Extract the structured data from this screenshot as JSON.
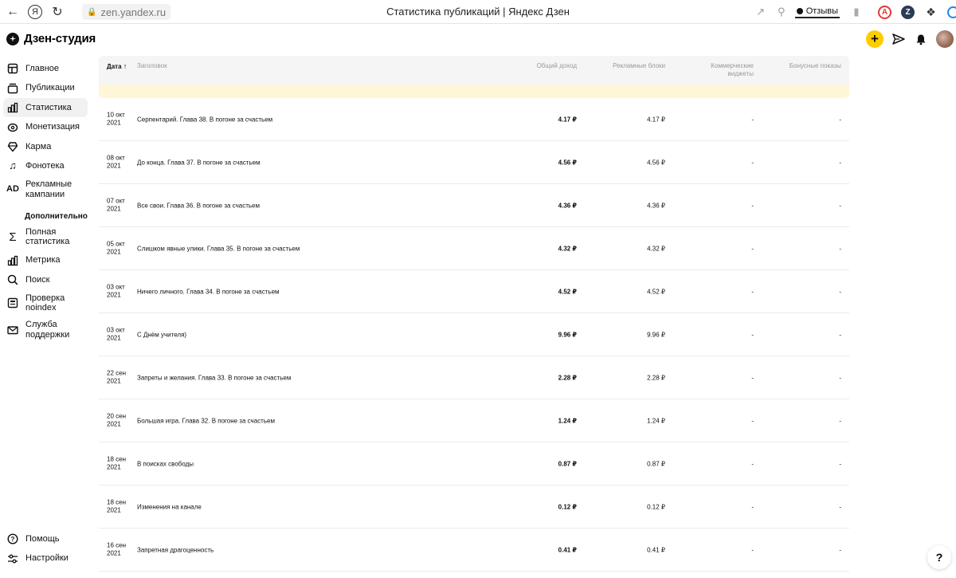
{
  "browser": {
    "url": "zen.yandex.ru",
    "tab_title": "Статистика публикаций | Яндекс Дзен",
    "reviews_label": "Отзывы",
    "ya_label": "Я"
  },
  "app": {
    "title": "Дзен-студия"
  },
  "sidebar": {
    "items": [
      {
        "label": "Главное",
        "icon": "home-icon"
      },
      {
        "label": "Публикации",
        "icon": "publications-icon"
      },
      {
        "label": "Статистика",
        "icon": "statistics-icon",
        "active": true
      },
      {
        "label": "Монетизация",
        "icon": "monetization-icon"
      },
      {
        "label": "Карма",
        "icon": "karma-icon"
      },
      {
        "label": "Фонотека",
        "icon": "music-icon"
      },
      {
        "label": "Рекламные кампании",
        "icon": "ad-icon",
        "glyph": "AD"
      }
    ],
    "section_title": "Дополнительно",
    "extra_items": [
      {
        "label": "Полная статистика",
        "icon": "sigma-icon"
      },
      {
        "label": "Метрика",
        "icon": "metrika-icon"
      },
      {
        "label": "Поиск",
        "icon": "search-icon"
      },
      {
        "label": "Проверка noindex",
        "icon": "noindex-icon"
      },
      {
        "label": "Служба поддержки",
        "icon": "mail-icon"
      }
    ],
    "bottom_items": [
      {
        "label": "Помощь",
        "icon": "help-icon"
      },
      {
        "label": "Настройки",
        "icon": "settings-icon"
      }
    ]
  },
  "table": {
    "columns": {
      "date": "Дата",
      "title": "Заголовок",
      "income": "Общий доход",
      "ads": "Рекламные блоки",
      "widgets_line1": "Коммерческие",
      "widgets_line2": "виджеты",
      "bonus": "Бонусные показы"
    },
    "rows": [
      {
        "date1": "10 окт",
        "date2": "2021",
        "title": "Серпентарий. Глава 38. В погоне за счастьем",
        "income": "4.17 ₽",
        "ads": "4.17 ₽",
        "widgets": "-",
        "bonus": "-"
      },
      {
        "date1": "08 окт",
        "date2": "2021",
        "title": "До конца. Глава 37. В погоне за счастьем",
        "income": "4.56 ₽",
        "ads": "4.56 ₽",
        "widgets": "-",
        "bonus": "-"
      },
      {
        "date1": "07 окт",
        "date2": "2021",
        "title": "Все свои. Глава 36. В погоне за счастьем",
        "income": "4.36 ₽",
        "ads": "4.36 ₽",
        "widgets": "-",
        "bonus": "-"
      },
      {
        "date1": "05 окт",
        "date2": "2021",
        "title": "Слишком явные улики. Глава 35. В погоне за счастьем",
        "income": "4.32 ₽",
        "ads": "4.32 ₽",
        "widgets": "-",
        "bonus": "-"
      },
      {
        "date1": "03 окт",
        "date2": "2021",
        "title": "Ничего личного. Глава 34. В погоне за счастьем",
        "income": "4.52 ₽",
        "ads": "4.52 ₽",
        "widgets": "-",
        "bonus": "-"
      },
      {
        "date1": "03 окт",
        "date2": "2021",
        "title": "С Днём учителя)",
        "income": "9.96 ₽",
        "ads": "9.96 ₽",
        "widgets": "-",
        "bonus": "-"
      },
      {
        "date1": "22 сен",
        "date2": "2021",
        "title": "Запреты и желания. Глава 33. В погоне за счастьем",
        "income": "2.28 ₽",
        "ads": "2.28 ₽",
        "widgets": "-",
        "bonus": "-"
      },
      {
        "date1": "20 сен",
        "date2": "2021",
        "title": "Большая игра. Глава 32. В погоне за счастьем",
        "income": "1.24 ₽",
        "ads": "1.24 ₽",
        "widgets": "-",
        "bonus": "-"
      },
      {
        "date1": "18 сен",
        "date2": "2021",
        "title": "В поисках свободы",
        "income": "0.87 ₽",
        "ads": "0.87 ₽",
        "widgets": "-",
        "bonus": "-"
      },
      {
        "date1": "18 сен",
        "date2": "2021",
        "title": "Изменения на канале",
        "income": "0.12 ₽",
        "ads": "0.12 ₽",
        "widgets": "-",
        "bonus": "-"
      },
      {
        "date1": "16 сен",
        "date2": "2021",
        "title": "Запретная драгоценность",
        "income": "0.41 ₽",
        "ads": "0.41 ₽",
        "widgets": "-",
        "bonus": "-"
      }
    ]
  },
  "help_fab": "?",
  "colors": {
    "accent_yellow": "#ffcc00",
    "band_yellow": "#fef6d6",
    "active_bg": "#f1f1f1"
  }
}
